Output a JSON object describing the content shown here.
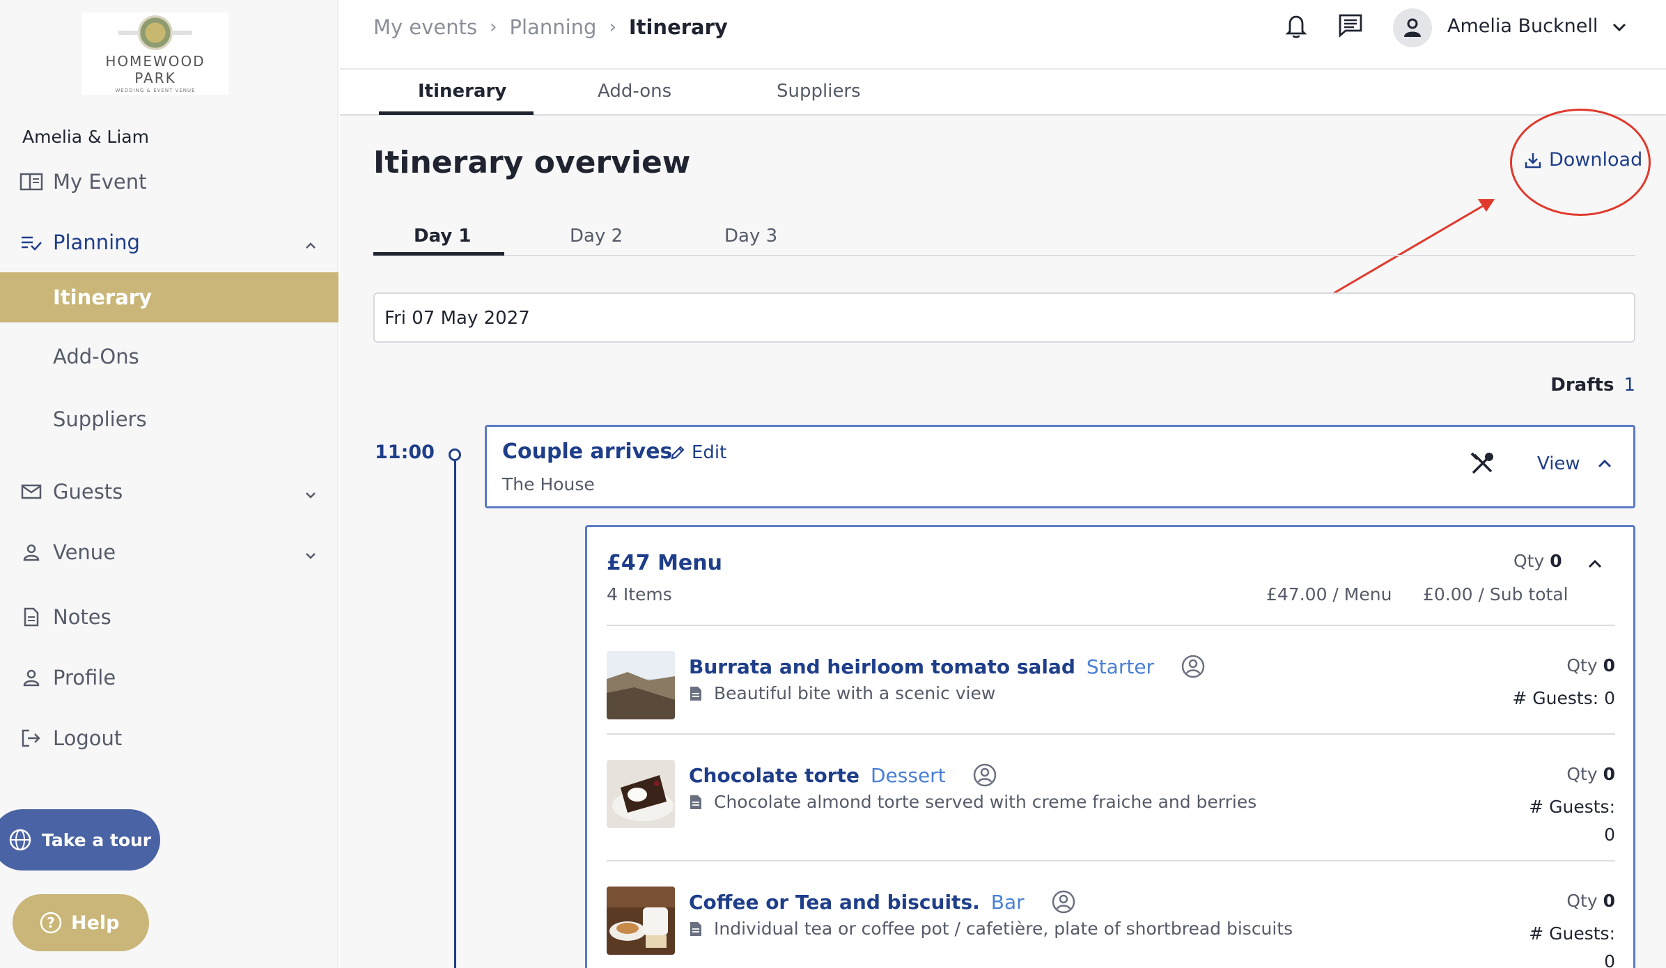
{
  "sidebar": {
    "logo": {
      "line1": "HOMEWOOD",
      "line2": "PARK",
      "line3": "WEDDING & EVENT VENUE"
    },
    "couple": "Amelia & Liam",
    "items": [
      {
        "label": "My Event",
        "icon": "book-open-icon"
      },
      {
        "label": "Planning",
        "icon": "checklist-icon"
      },
      {
        "label": "Itinerary"
      },
      {
        "label": "Add-Ons"
      },
      {
        "label": "Suppliers"
      },
      {
        "label": "Guests",
        "icon": "mail-icon"
      },
      {
        "label": "Venue",
        "icon": "person-icon"
      },
      {
        "label": "Notes",
        "icon": "document-icon"
      },
      {
        "label": "Profile",
        "icon": "person-icon"
      },
      {
        "label": "Logout",
        "icon": "logout-icon"
      }
    ],
    "tour_label": "Take a tour",
    "help_label": "Help"
  },
  "header": {
    "breadcrumb": [
      "My events",
      "Planning",
      "Itinerary"
    ],
    "user_name": "Amelia Bucknell"
  },
  "tabs": [
    "Itinerary",
    "Add-ons",
    "Suppliers"
  ],
  "main": {
    "title": "Itinerary overview",
    "download_label": "Download",
    "day_tabs": [
      "Day 1",
      "Day 2",
      "Day 3"
    ],
    "date": "Fri 07 May 2027",
    "drafts_label": "Drafts",
    "drafts_count": "1",
    "event": {
      "time": "11:00",
      "title": "Couple arrives",
      "edit_label": "Edit",
      "location": "The House",
      "view_label": "View"
    },
    "menu": {
      "title": "£47 Menu",
      "items_count": "4 Items",
      "qty_label": "Qty",
      "qty_value": "0",
      "price": "£47.00 / Menu",
      "subtotal": "£0.00 / Sub total",
      "items": [
        {
          "name": "Burrata and heirloom tomato salad",
          "category": "Starter",
          "description": "Beautiful bite with a scenic view",
          "qty_label": "Qty",
          "qty": "0",
          "guests": "# Guests: 0"
        },
        {
          "name": "Chocolate torte",
          "category": "Dessert",
          "description": "Chocolate almond torte served with creme fraiche and berries",
          "qty_label": "Qty",
          "qty": "0",
          "guests_label": "# Guests:",
          "guests_value": "0"
        },
        {
          "name": "Coffee or Tea and biscuits.",
          "category": "Bar",
          "description": "Individual tea or coffee pot / cafetière, plate of shortbread biscuits",
          "qty_label": "Qty",
          "qty": "0",
          "guests_label": "# Guests:",
          "guests_value": "0"
        }
      ]
    }
  },
  "colors": {
    "brand_gold": "#c9b678",
    "primary_blue": "#1f3e8a",
    "tour_blue": "#4a63a4",
    "annotation_red": "#e0392b"
  }
}
